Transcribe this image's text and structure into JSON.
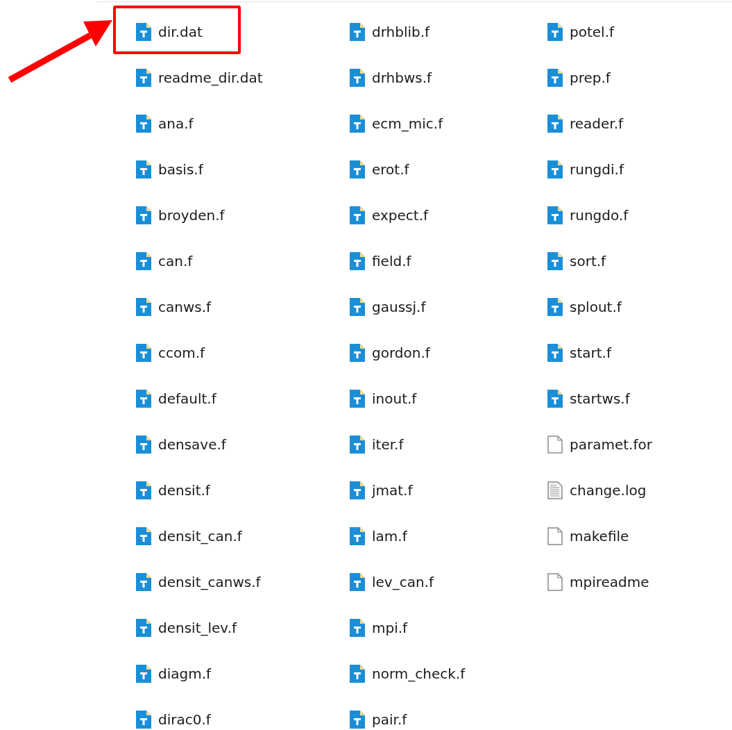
{
  "files": [
    {
      "name": "dir.dat",
      "kind": "text",
      "highlighted": true
    },
    {
      "name": "readme_dir.dat",
      "kind": "text",
      "highlighted": false
    },
    {
      "name": "ana.f",
      "kind": "text",
      "highlighted": false
    },
    {
      "name": "basis.f",
      "kind": "text",
      "highlighted": false
    },
    {
      "name": "broyden.f",
      "kind": "text",
      "highlighted": false
    },
    {
      "name": "can.f",
      "kind": "text",
      "highlighted": false
    },
    {
      "name": "canws.f",
      "kind": "text",
      "highlighted": false
    },
    {
      "name": "ccom.f",
      "kind": "text",
      "highlighted": false
    },
    {
      "name": "default.f",
      "kind": "text",
      "highlighted": false
    },
    {
      "name": "densave.f",
      "kind": "text",
      "highlighted": false
    },
    {
      "name": "densit.f",
      "kind": "text",
      "highlighted": false
    },
    {
      "name": "densit_can.f",
      "kind": "text",
      "highlighted": false
    },
    {
      "name": "densit_canws.f",
      "kind": "text",
      "highlighted": false
    },
    {
      "name": "densit_lev.f",
      "kind": "text",
      "highlighted": false
    },
    {
      "name": "diagm.f",
      "kind": "text",
      "highlighted": false
    },
    {
      "name": "dirac0.f",
      "kind": "text",
      "highlighted": false
    },
    {
      "name": "drhblib.f",
      "kind": "text",
      "highlighted": false
    },
    {
      "name": "drhbws.f",
      "kind": "text",
      "highlighted": false
    },
    {
      "name": "ecm_mic.f",
      "kind": "text",
      "highlighted": false
    },
    {
      "name": "erot.f",
      "kind": "text",
      "highlighted": false
    },
    {
      "name": "expect.f",
      "kind": "text",
      "highlighted": false
    },
    {
      "name": "field.f",
      "kind": "text",
      "highlighted": false
    },
    {
      "name": "gaussj.f",
      "kind": "text",
      "highlighted": false
    },
    {
      "name": "gordon.f",
      "kind": "text",
      "highlighted": false
    },
    {
      "name": "inout.f",
      "kind": "text",
      "highlighted": false
    },
    {
      "name": "iter.f",
      "kind": "text",
      "highlighted": false
    },
    {
      "name": "jmat.f",
      "kind": "text",
      "highlighted": false
    },
    {
      "name": "lam.f",
      "kind": "text",
      "highlighted": false
    },
    {
      "name": "lev_can.f",
      "kind": "text",
      "highlighted": false
    },
    {
      "name": "mpi.f",
      "kind": "text",
      "highlighted": false
    },
    {
      "name": "norm_check.f",
      "kind": "text",
      "highlighted": false
    },
    {
      "name": "pair.f",
      "kind": "text",
      "highlighted": false
    },
    {
      "name": "potel.f",
      "kind": "text",
      "highlighted": false
    },
    {
      "name": "prep.f",
      "kind": "text",
      "highlighted": false
    },
    {
      "name": "reader.f",
      "kind": "text",
      "highlighted": false
    },
    {
      "name": "rungdi.f",
      "kind": "text",
      "highlighted": false
    },
    {
      "name": "rungdo.f",
      "kind": "text",
      "highlighted": false
    },
    {
      "name": "sort.f",
      "kind": "text",
      "highlighted": false
    },
    {
      "name": "splout.f",
      "kind": "text",
      "highlighted": false
    },
    {
      "name": "start.f",
      "kind": "text",
      "highlighted": false
    },
    {
      "name": "startws.f",
      "kind": "text",
      "highlighted": false
    },
    {
      "name": "paramet.for",
      "kind": "blank",
      "highlighted": false
    },
    {
      "name": "change.log",
      "kind": "lines",
      "highlighted": false
    },
    {
      "name": "makefile",
      "kind": "blank",
      "highlighted": false
    },
    {
      "name": "mpireadme",
      "kind": "blank",
      "highlighted": false
    }
  ]
}
